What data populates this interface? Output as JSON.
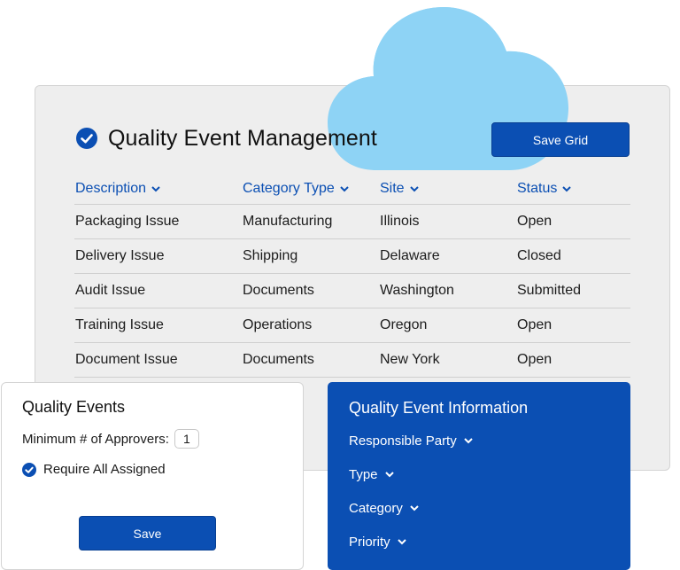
{
  "colors": {
    "accent": "#0b4fb3",
    "cloud": "#8ed3f5",
    "card_bg": "#eeeeee"
  },
  "main": {
    "title": "Quality Event Management",
    "save_grid_label": "Save Grid",
    "columns": [
      {
        "label": "Description"
      },
      {
        "label": "Category Type"
      },
      {
        "label": "Site"
      },
      {
        "label": "Status"
      }
    ],
    "rows": [
      {
        "description": "Packaging Issue",
        "category": "Manufacturing",
        "site": "Illinois",
        "status": "Open"
      },
      {
        "description": "Delivery Issue",
        "category": "Shipping",
        "site": "Delaware",
        "status": "Closed"
      },
      {
        "description": "Audit Issue",
        "category": "Documents",
        "site": "Washington",
        "status": "Submitted"
      },
      {
        "description": "Training Issue",
        "category": "Operations",
        "site": "Oregon",
        "status": "Open"
      },
      {
        "description": "Document Issue",
        "category": "Documents",
        "site": "New York",
        "status": "Open"
      }
    ]
  },
  "quality_events": {
    "title": "Quality Events",
    "approvers_label": "Minimum # of Approvers:",
    "approvers_value": "1",
    "require_label": "Require All Assigned",
    "save_label": "Save"
  },
  "info_panel": {
    "title": "Quality Event Information",
    "items": [
      {
        "label": "Responsible Party"
      },
      {
        "label": "Type"
      },
      {
        "label": "Category"
      },
      {
        "label": "Priority"
      }
    ]
  },
  "icons": [
    "check-circle-icon",
    "chevron-down-icon",
    "cloud-icon"
  ]
}
